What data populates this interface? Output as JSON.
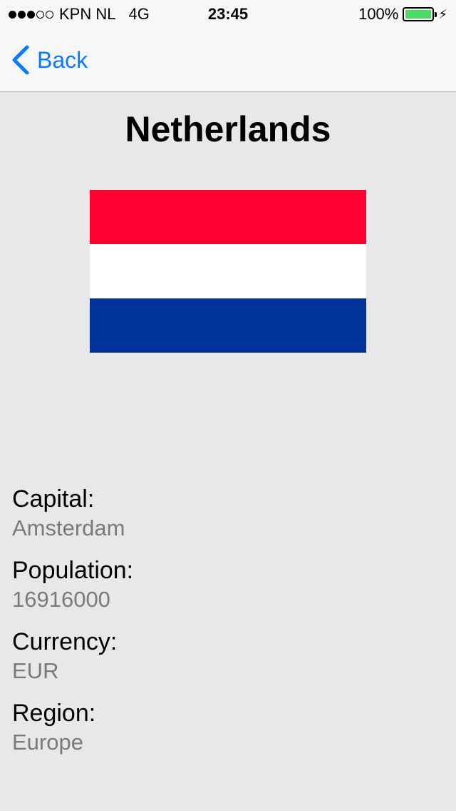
{
  "status": {
    "carrier": "KPN NL",
    "network": "4G",
    "time": "23:45",
    "battery_text": "100%",
    "signal_bars_filled": 3,
    "signal_bars_total": 5,
    "battery_level": 1.0
  },
  "nav": {
    "back_label": "Back"
  },
  "country": {
    "name": "Netherlands",
    "flag_colors": [
      "#ff0033",
      "#ffffff",
      "#003399"
    ]
  },
  "details": [
    {
      "label": "Capital:",
      "value": "Amsterdam"
    },
    {
      "label": "Population:",
      "value": "16916000"
    },
    {
      "label": "Currency:",
      "value": "EUR"
    },
    {
      "label": "Region:",
      "value": "Europe"
    }
  ],
  "colors": {
    "accent": "#0a7aff",
    "background": "#e8e8e8",
    "secondary_text": "#7a7a7a",
    "battery": "#4cd964"
  }
}
